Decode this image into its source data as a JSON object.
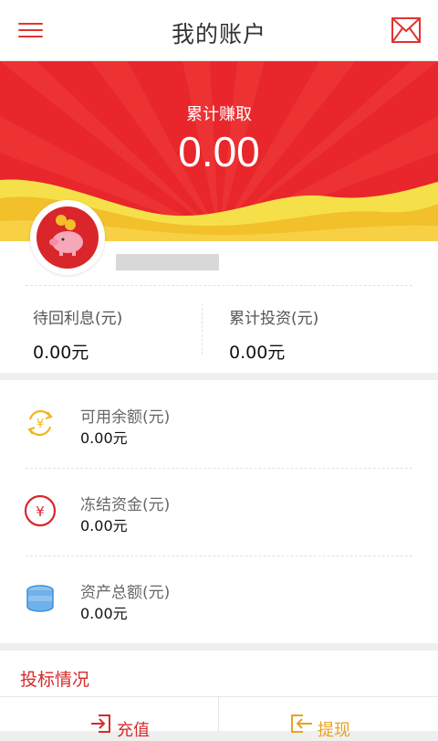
{
  "header": {
    "title": "我的账户",
    "menu_icon": "hamburger-menu-icon",
    "message_icon": "envelope-icon"
  },
  "summary": {
    "label": "累计赚取",
    "amount": "0.00"
  },
  "profile": {
    "avatar_icon": "piggy-bank-icon"
  },
  "stats": [
    {
      "label": "待回利息(元)",
      "value": "0.00元"
    },
    {
      "label": "累计投资(元)",
      "value": "0.00元"
    }
  ],
  "funds": [
    {
      "icon": "currency-exchange-icon",
      "label": "可用余额(元)",
      "value": "0.00元"
    },
    {
      "icon": "yen-circle-icon",
      "label": "冻结资金(元)",
      "value": "0.00元"
    },
    {
      "icon": "coin-stack-icon",
      "label": "资产总额(元)",
      "value": "0.00元"
    }
  ],
  "bidding": {
    "title": "投标情况"
  },
  "actions": {
    "recharge_label": "充值",
    "withdraw_label": "提现"
  },
  "colors": {
    "primary_red": "#e8262b",
    "accent_gold": "#f2c02a",
    "withdraw_orange": "#e8a221"
  }
}
